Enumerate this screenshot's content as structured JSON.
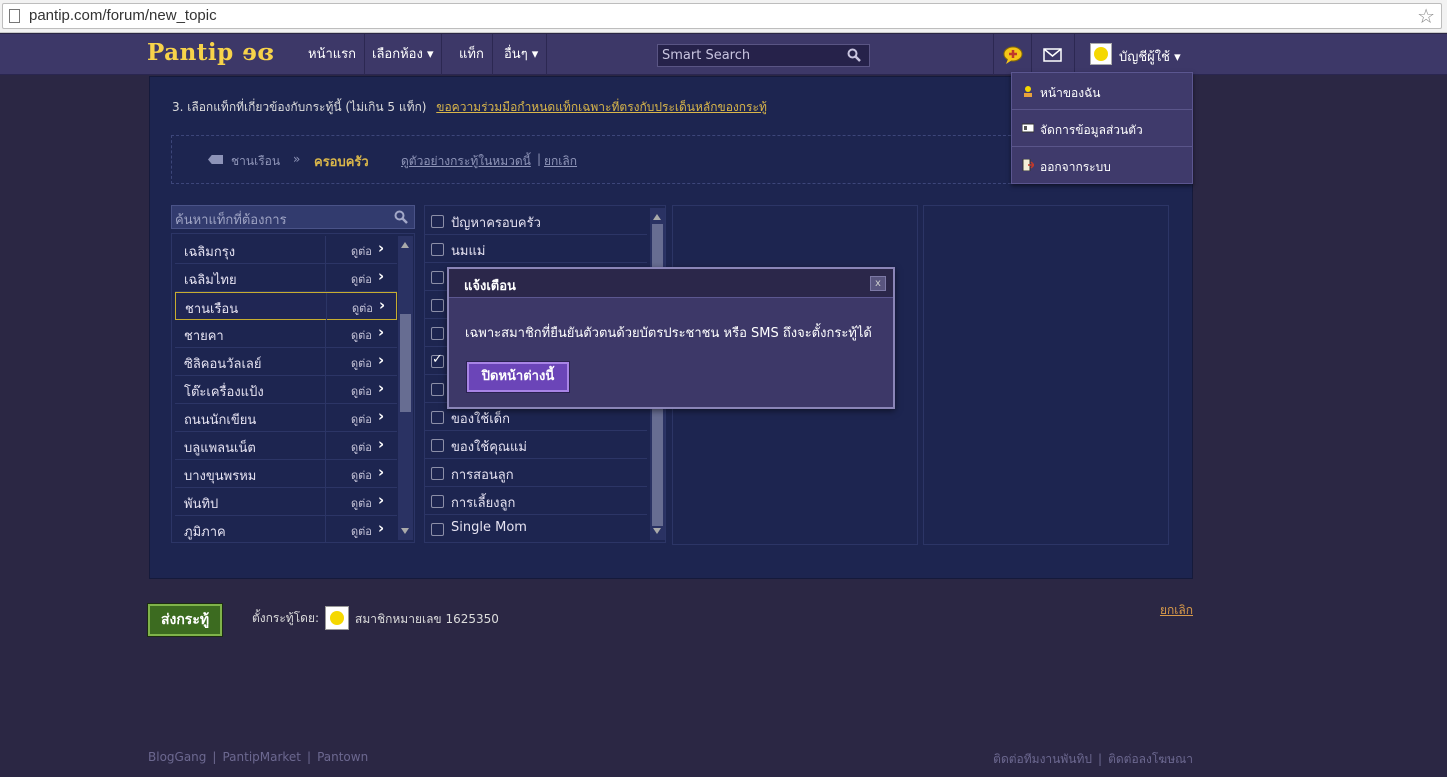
{
  "browser": {
    "url": "pantip.com/forum/new_topic"
  },
  "nav": {
    "logo": "Pantip ɘɞ",
    "items": [
      "หน้าแรก",
      "เลือกห้อง ▾",
      "แท็ก",
      "อื่นๆ ▾"
    ],
    "search_placeholder": "Smart Search",
    "account_label": "บัญชีผู้ใช้ ▾"
  },
  "account_menu": [
    "หน้าของฉัน",
    "จัดการข้อมูลส่วนตัว",
    "ออกจากระบบ"
  ],
  "panel": {
    "step": "3. เลือกแท็กที่เกี่ยวข้องกับกระทู้นี้ (ไม่เกิน 5 แท็ก)",
    "step_link": "ขอความร่วมมือกำหนดแท็กเฉพาะที่ตรงกับประเด็นหลักของกระทู้",
    "crumb_root": "ชานเรือน",
    "crumb_sep": "»",
    "crumb_current": "ครอบครัว",
    "example_link": "ดูตัวอย่างกระทู้ในหมวดนี้",
    "divider": "|",
    "cancel_link": "ยกเลิก",
    "tag_search_placeholder": "ค้นหาแท็กที่ต้องการ",
    "view_label": "ดูต่อ",
    "col1": [
      "เฉลิมกรุง",
      "เฉลิมไทย",
      "ชานเรือน",
      "ชายคา",
      "ซิลิคอนวัลเลย์",
      "โต๊ะเครื่องแป้ง",
      "ถนนนักเขียน",
      "บลูแพลนเน็ต",
      "บางขุนพรหม",
      "พันทิป",
      "ภูมิภาค"
    ],
    "col1_selected_index": 2,
    "col2": [
      {
        "label": "ปัญหาครอบครัว",
        "checked": false
      },
      {
        "label": "นมแม่",
        "checked": false
      },
      {
        "label": "",
        "checked": false
      },
      {
        "label": "",
        "checked": false
      },
      {
        "label": "",
        "checked": false
      },
      {
        "label": "",
        "checked": true
      },
      {
        "label": "",
        "checked": false
      },
      {
        "label": "ของใช้เด็ก",
        "checked": false
      },
      {
        "label": "ของใช้คุณแม่",
        "checked": false
      },
      {
        "label": "การสอนลูก",
        "checked": false
      },
      {
        "label": "การเลี้ยงลูก",
        "checked": false
      },
      {
        "label": "Single Mom",
        "checked": false
      }
    ]
  },
  "modal": {
    "title": "แจ้งเตือน",
    "close": "x",
    "message": "เฉพาะสมาชิกที่ยืนยันตัวตนด้วยบัตรประชาชน หรือ SMS ถึงจะตั้งกระทู้ได้",
    "button": "ปิดหน้าต่างนี้"
  },
  "form": {
    "submit": "ส่งกระทู้",
    "poster_label": "ตั้งกระทู้โดย:",
    "member": "สมาชิกหมายเลข 1625350",
    "cancel": "ยกเลิก"
  },
  "footer": {
    "left": [
      "BlogGang",
      "PantipMarket",
      "Pantown"
    ],
    "right": [
      "ติดต่อทีมงานพันทิป",
      "ติดต่อลงโฆษณา"
    ]
  },
  "colors": {
    "nav_bg": "#3d3868",
    "page_bg": "#2b2744",
    "panel_bg": "#1d2550",
    "accent_gold": "#d9b64a",
    "modal_button": "#6b45b8",
    "submit_green": "#3c6b20"
  }
}
